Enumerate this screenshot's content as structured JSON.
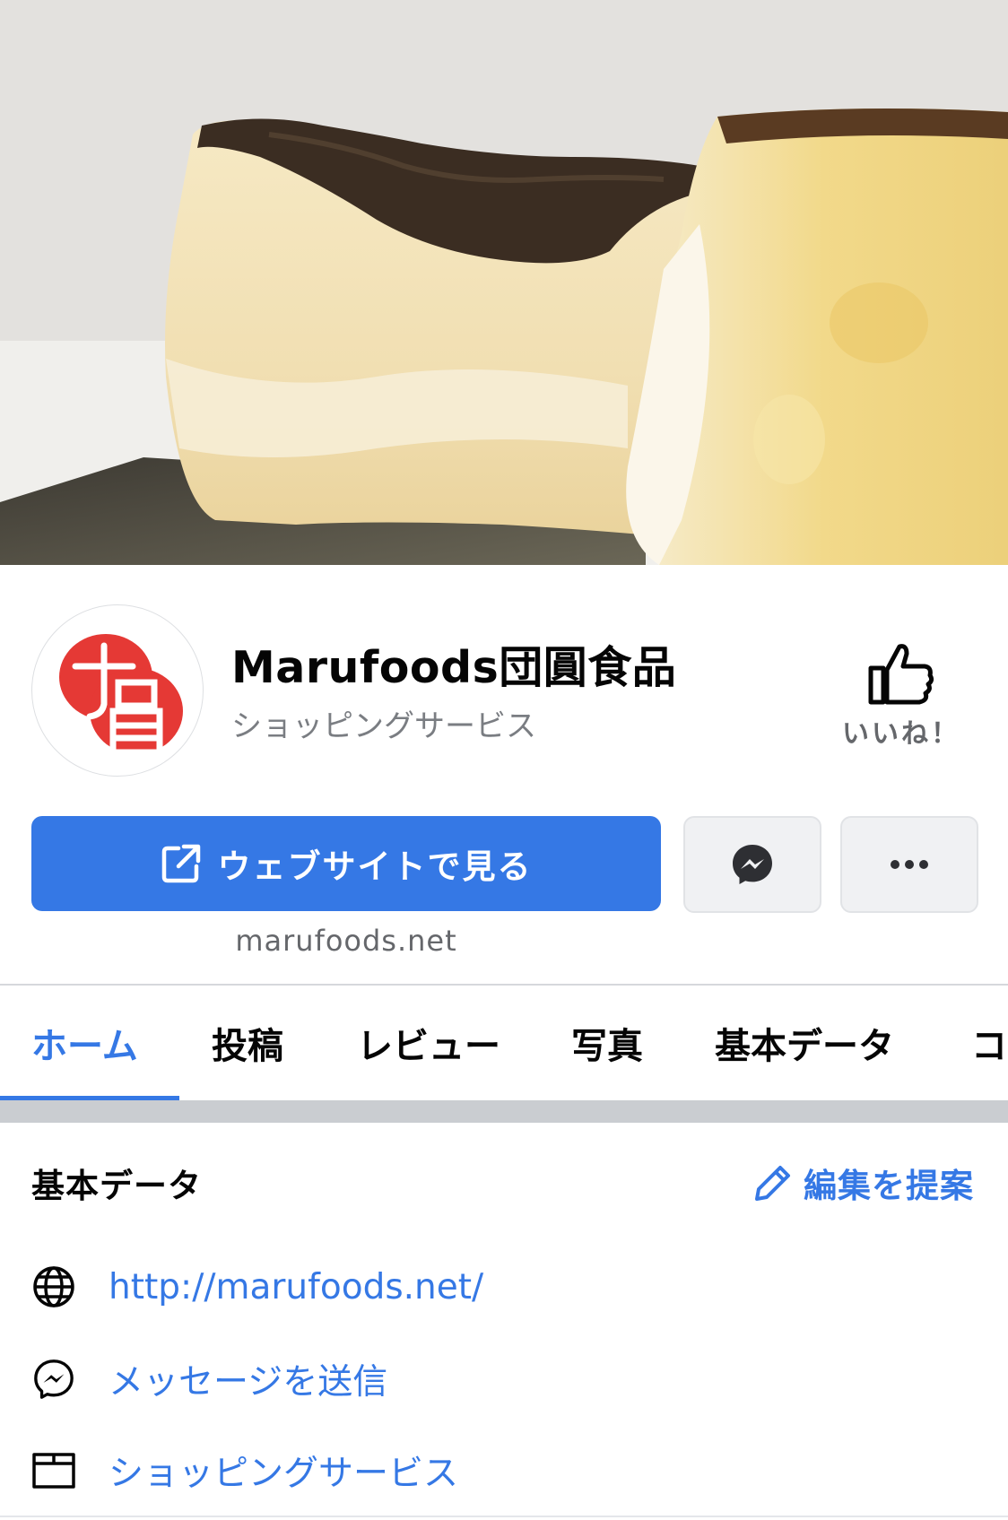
{
  "page": {
    "name": "Marufoods団圓食品",
    "category": "ショッピングサービス",
    "avatar_glyph": "圓"
  },
  "actions": {
    "like_label": "いいね！",
    "website_label": "ウェブサイトで見る",
    "website_caption": "marufoods.net",
    "messenger_icon": "messenger-icon",
    "more_icon": "more-dots-icon"
  },
  "tabs": [
    {
      "label": "ホーム",
      "active": true
    },
    {
      "label": "投稿"
    },
    {
      "label": "レビュー"
    },
    {
      "label": "写真"
    },
    {
      "label": "基本データ"
    },
    {
      "label": "コ"
    }
  ],
  "about": {
    "title": "基本データ",
    "suggest_edit": "編集を提案",
    "items": [
      {
        "icon": "globe-icon",
        "text": "http://marufoods.net/"
      },
      {
        "icon": "messenger-icon",
        "text": "メッセージを送信"
      },
      {
        "icon": "shop-icon",
        "text": "ショッピングサービス"
      }
    ]
  },
  "colors": {
    "accent": "#3578e5",
    "secondary_text": "#65676b",
    "logo_red": "#e53935"
  }
}
